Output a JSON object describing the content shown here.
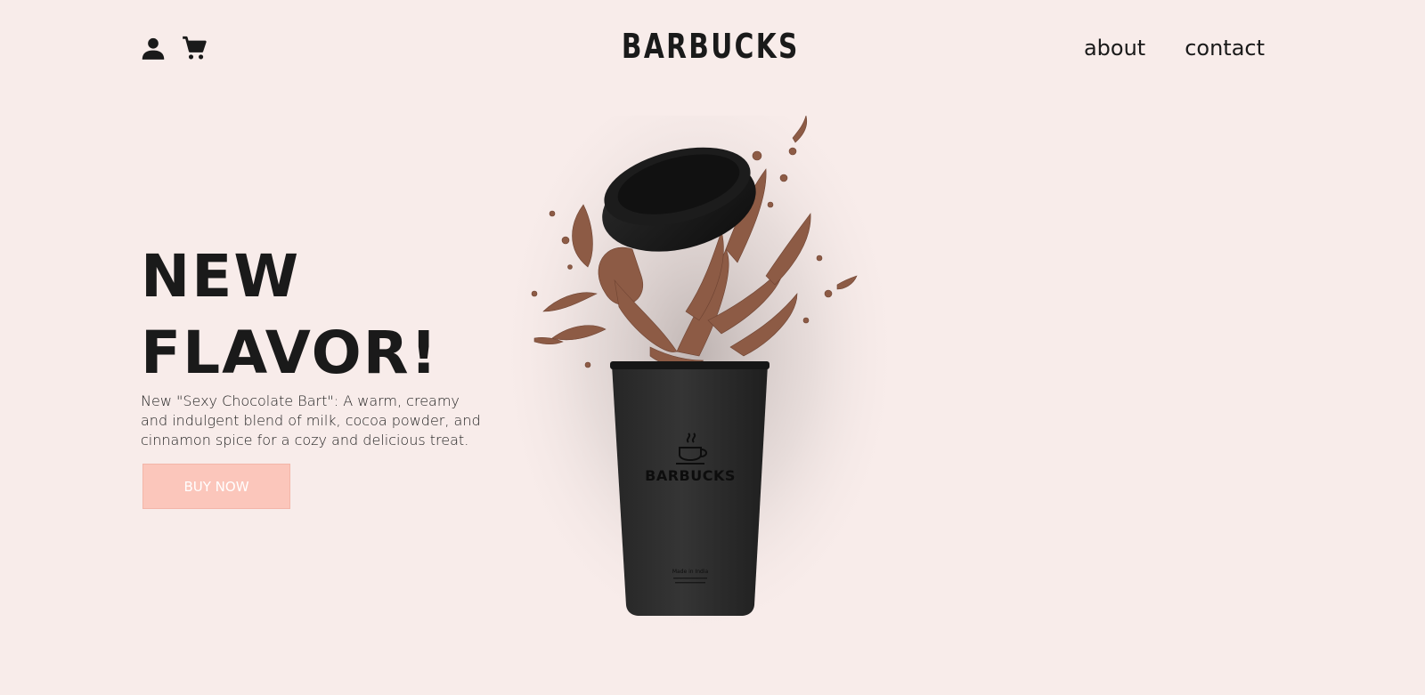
{
  "header": {
    "logo": "BARBUCKS",
    "icons": [
      "user-icon",
      "cart-icon"
    ],
    "nav": [
      {
        "label": "about"
      },
      {
        "label": "contact"
      }
    ]
  },
  "hero": {
    "title_line1": "NEW",
    "title_line2": "FLAVOR!",
    "description": "New \"Sexy Chocolate Bart\": A warm, creamy and indulgent blend of milk, cocoa powder, and cinnamon spice for a cozy and delicious treat.",
    "button_label": "BUY NOW"
  },
  "product": {
    "cup_brand": "BARBUCKS",
    "cup_small_text": "Made in India"
  },
  "colors": {
    "background": "#f8ecea",
    "accent_button": "#fbc6bb",
    "text": "#1a1a1a",
    "cup": "#2a2a2a",
    "chocolate": "#8a5a44"
  }
}
